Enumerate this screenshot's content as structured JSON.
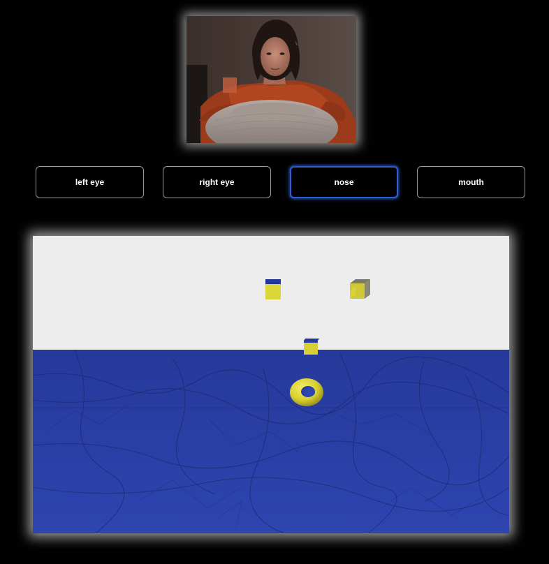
{
  "webcam": {
    "label": "webcam-preview"
  },
  "buttons": [
    {
      "label": "left eye",
      "active": false
    },
    {
      "label": "right eye",
      "active": false
    },
    {
      "label": "nose",
      "active": true
    },
    {
      "label": "mouth",
      "active": false
    }
  ],
  "scene": {
    "sky_color": "#ededed",
    "floor_color": "#2a3da0",
    "object_color": "#e8e23a",
    "cube_top_color": "#23379a"
  },
  "colors": {
    "background": "#000000",
    "button_border": "#9a9a9a",
    "active_border": "#2f5fd0",
    "text": "#ffffff"
  }
}
